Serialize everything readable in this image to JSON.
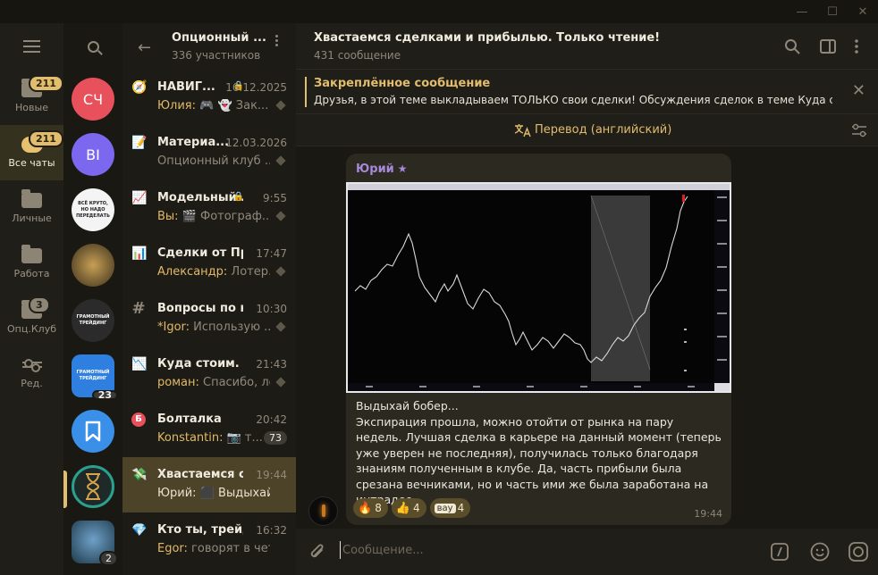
{
  "rail": {
    "folders": [
      {
        "label": "Новые",
        "badge": "211"
      },
      {
        "label": "Все чаты",
        "badge": "211"
      },
      {
        "label": "Личные",
        "badge": ""
      },
      {
        "label": "Работа",
        "badge": ""
      },
      {
        "label": "Опц.Клуб",
        "badge": "3"
      },
      {
        "label": "Ред.",
        "badge": ""
      }
    ]
  },
  "avatars": [
    {
      "text": "СЧ",
      "color": "#e8505b",
      "count": ""
    },
    {
      "text": "BI",
      "color": "#7b68ee",
      "count": ""
    },
    {
      "text": "ВСЁ КРУТО, НО НАДО ПЕРЕДЕЛАТЬ",
      "color": "#f4f4f4",
      "count": ""
    },
    {
      "text": "",
      "color": "#5a4a2a",
      "count": ""
    },
    {
      "text": "ГРАМОТНЫЙ ТРЕЙДИНГ",
      "color": "#2b2b2b",
      "count": ""
    },
    {
      "text": "ГРАМОТНЫЙ ТРЕЙДИНГ",
      "color": "#2f7fe0",
      "count": "23"
    },
    {
      "text": "",
      "color": "#3a8fe8",
      "count": ""
    },
    {
      "text": "",
      "color": "#1f2a28",
      "count": ""
    },
    {
      "text": "",
      "color": "#1d3a4a",
      "count": "2"
    }
  ],
  "chatlist": {
    "group_name": "Опционный ...",
    "group_members": "336 участников",
    "rows": [
      {
        "icon": "🧭",
        "title": "НАВИГ...",
        "time": "16.12.2025",
        "lock": true,
        "sender": "Юлия:",
        "text": " 🎮 👻 Зак...",
        "pinned": true,
        "unread": ""
      },
      {
        "icon": "📝",
        "title": "Материа...",
        "time": "12.03.2026",
        "lock": false,
        "sender": "",
        "text": "Опционный клуб ...",
        "pinned": true,
        "unread": ""
      },
      {
        "icon": "📈",
        "title": "Модельный ...",
        "time": "9:55",
        "lock": true,
        "sender": "Вы:",
        "text": " 🎬 Фотограф...",
        "pinned": true,
        "unread": ""
      },
      {
        "icon": "📊",
        "title": "Сделки от Пре...",
        "time": "17:47",
        "lock": false,
        "sender": "Александр:",
        "text": " Лотер...",
        "pinned": true,
        "unread": ""
      },
      {
        "icon": "#",
        "title": "Вопросы по ку...",
        "time": "10:30",
        "lock": false,
        "sender": "*Igor:",
        "text": " Использую ...",
        "pinned": true,
        "unread": ""
      },
      {
        "icon": "📉",
        "title": "Куда стоим. О...",
        "time": "21:43",
        "lock": false,
        "sender": "роман:",
        "text": " Спасибо, логи...",
        "pinned": true,
        "unread": ""
      },
      {
        "icon": "Б",
        "title": "Болталка",
        "time": "20:42",
        "lock": false,
        "sender": "Konstantin:",
        "text": " 📷 т...",
        "pinned": false,
        "unread": "73"
      },
      {
        "icon": "💸",
        "title": "Хвастаемся сд...",
        "time": "19:44",
        "lock": false,
        "sender": "Юрий:",
        "text": " ⬛ Выдыхай б...",
        "pinned": false,
        "unread": ""
      },
      {
        "icon": "💎",
        "title": "Кто ты, трейде...",
        "time": "16:32",
        "lock": false,
        "sender": "Egor:",
        "text": " говорят в четве...",
        "pinned": false,
        "unread": ""
      }
    ]
  },
  "main": {
    "title": "Хвастаемся сделками и прибылью. Только чтение!",
    "count": "431 сообщение",
    "pinned_title": "Закреплённое сообщение",
    "pinned_text": "Друзья, в этой теме выкладываем ТОЛЬКО свои сделки!  Обсуждения сделок в теме Куда ст...",
    "translate_label": "Перевод (английский)",
    "message": {
      "author": "Юрий",
      "text": "Выдыхай бобер...\nЭкспирация прошла, можно отойти от рынка на пару недель. Лучшая сделка в карьере на данный момент (теперь уже уверен не последняя), получилась только благодаря знаниям полученным в клубе. Да, часть прибыли была срезана вечниками, но и часть ими же была заработана на интрадее.",
      "time": "19:44",
      "reactions": [
        {
          "emoji": "🔥",
          "count": "8"
        },
        {
          "emoji": "👍",
          "count": "4"
        },
        {
          "emoji": "вау",
          "count": "4"
        }
      ]
    },
    "composer_placeholder": "Сообщение..."
  },
  "colors": {
    "accent": "#e2bd6d",
    "author": "#a689d9",
    "active_row": "#4c4328"
  }
}
